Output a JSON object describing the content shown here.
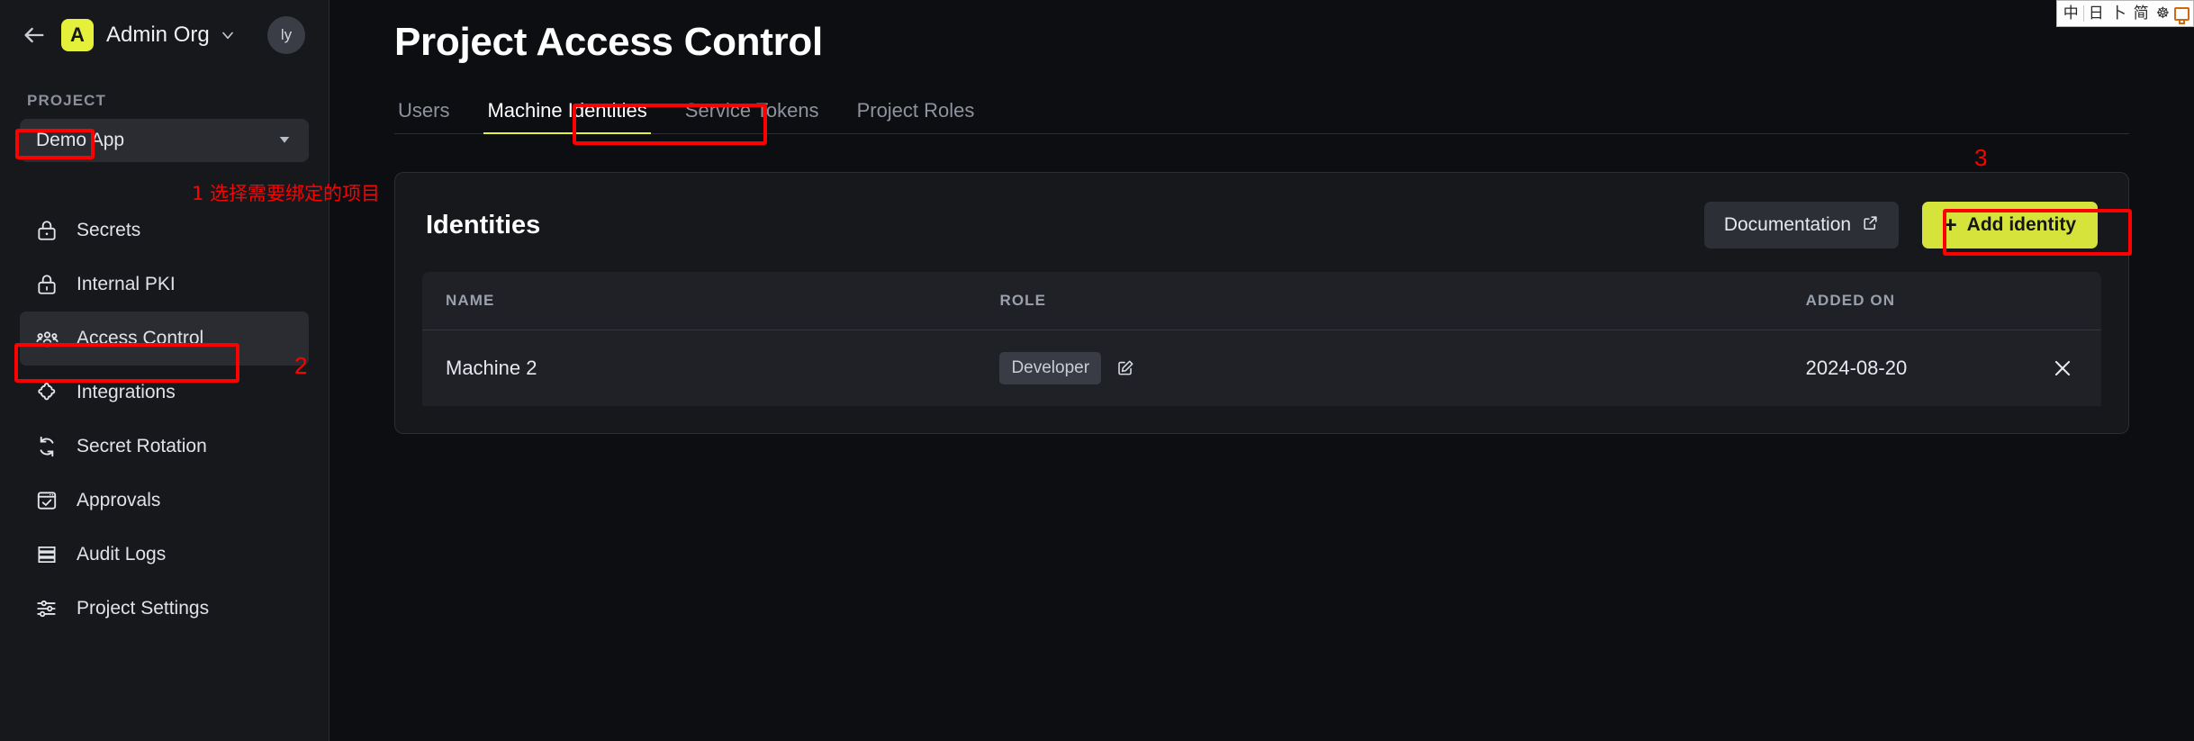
{
  "sidebar": {
    "back_icon": "arrow-left-icon",
    "org": {
      "badge_letter": "A",
      "name": "Admin Org",
      "badge_color": "#e4f03a"
    },
    "avatar_initials": "ly",
    "project_section_label": "PROJECT",
    "project_selected": "Demo App",
    "items": [
      {
        "label": "Secrets",
        "icon": "lock-icon",
        "active": false
      },
      {
        "label": "Internal PKI",
        "icon": "lock-closed-icon",
        "active": false
      },
      {
        "label": "Access Control",
        "icon": "users-group-icon",
        "active": true
      },
      {
        "label": "Integrations",
        "icon": "puzzle-piece-icon",
        "active": false
      },
      {
        "label": "Secret Rotation",
        "icon": "refresh-cycle-icon",
        "active": false
      },
      {
        "label": "Approvals",
        "icon": "checkbox-window-icon",
        "active": false
      },
      {
        "label": "Audit Logs",
        "icon": "list-rows-icon",
        "active": false
      },
      {
        "label": "Project Settings",
        "icon": "sliders-icon",
        "active": false
      }
    ]
  },
  "main": {
    "page_title": "Project Access Control",
    "tabs": [
      {
        "label": "Users",
        "active": false
      },
      {
        "label": "Machine Identities",
        "active": true
      },
      {
        "label": "Service Tokens",
        "active": false
      },
      {
        "label": "Project Roles",
        "active": false
      }
    ],
    "card": {
      "title": "Identities",
      "documentation_label": "Documentation",
      "documentation_icon": "external-link-icon",
      "add_identity_label": "Add identity",
      "add_identity_plus": "+",
      "add_identity_color": "#d6e33a",
      "table": {
        "columns": [
          "NAME",
          "ROLE",
          "ADDED ON"
        ],
        "rows": [
          {
            "name": "Machine 2",
            "role": "Developer",
            "edit_icon": "edit-pencil-icon",
            "added_on": "2024-08-20",
            "delete_icon": "close-x-icon"
          }
        ]
      }
    }
  },
  "annotations": {
    "step1_text": "1 选择需要绑定的项目",
    "step2_number": "2",
    "step3_number": "3",
    "highlight_color": "#fe0000"
  },
  "ime_bar": {
    "items": [
      "中",
      "日",
      "卜",
      "简",
      "☸"
    ],
    "keyboard_icon": "keyboard-icon"
  }
}
